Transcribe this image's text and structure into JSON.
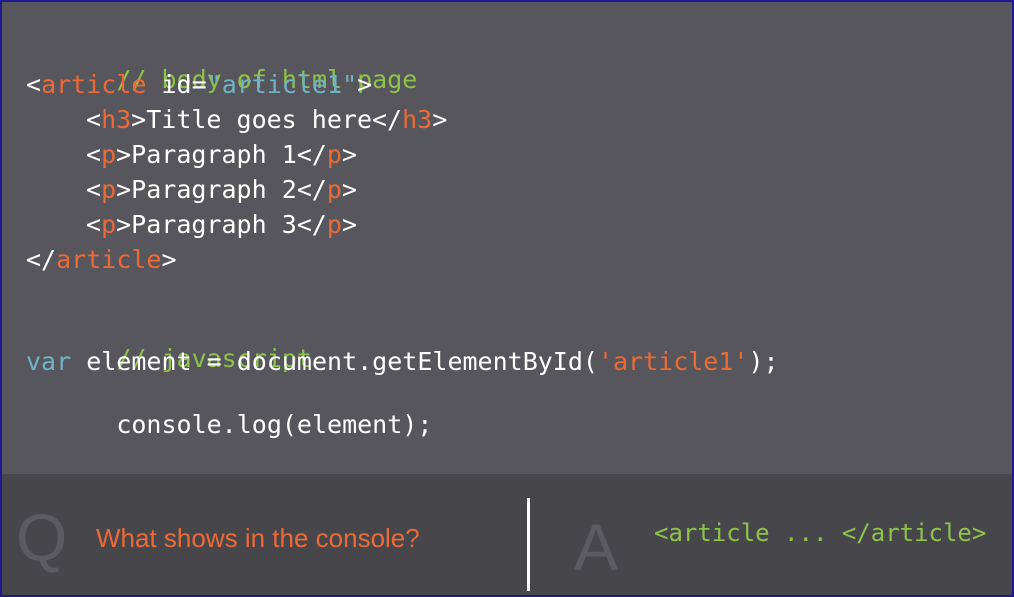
{
  "code": {
    "html_comment": "// body of html page",
    "article_open_lt": "<",
    "article_tag": "article",
    "article_attr_name": " id=",
    "article_attr_value": "\"article1\"",
    "article_open_gt": ">",
    "h3_lt": "<",
    "h3_tag": "h3",
    "h3_text": ">Title goes here</",
    "h3_close_tag": "h3",
    "h3_gt": ">",
    "p1_lt": "<",
    "p1_tag": "p",
    "p1_text": ">Paragraph 1</",
    "p1_close_tag": "p",
    "p1_gt": ">",
    "p2_lt": "<",
    "p2_tag": "p",
    "p2_text": ">Paragraph 2</",
    "p2_close_tag": "p",
    "p2_gt": ">",
    "p3_lt": "<",
    "p3_tag": "p",
    "p3_text": ">Paragraph 3</",
    "p3_close_tag": "p",
    "p3_gt": ">",
    "article_close_lt": "</",
    "article_close_tag": "article",
    "article_close_gt": ">",
    "js_comment": "// javascript",
    "js_var": "var",
    "js_mid": " element = document.getElementById(",
    "js_string": "'article1'",
    "js_end": ");",
    "js_log": "console.log(element);"
  },
  "qa": {
    "q_letter": "Q",
    "question": "What shows in the console?",
    "a_letter": "A",
    "answer": "<article ... </article>"
  },
  "colors": {
    "background": "#57565c",
    "tag": "#ec6a35",
    "comment": "#8ec34a",
    "attribute": "#6fb3c6",
    "text": "#ffffff"
  }
}
